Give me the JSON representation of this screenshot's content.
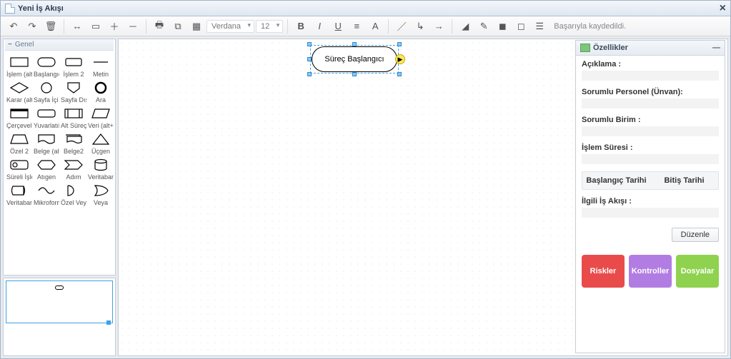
{
  "window": {
    "title": "Yeni İş Akışı"
  },
  "toolbar": {
    "font_family": "Verdana",
    "font_size": "12",
    "status": "Başarıyla kaydedildi."
  },
  "palette": {
    "group_title": "Genel",
    "shapes": [
      {
        "name": "rect",
        "label": "İşlem (alt+"
      },
      {
        "name": "roundrect",
        "label": "Başlangıç/"
      },
      {
        "name": "rect2",
        "label": "İşlem 2"
      },
      {
        "name": "text",
        "label": "Metin"
      },
      {
        "name": "diamond",
        "label": "Karar (alt+"
      },
      {
        "name": "circle",
        "label": "Sayfa İçi E"
      },
      {
        "name": "offpage",
        "label": "Sayfa Dış"
      },
      {
        "name": "boldcircle",
        "label": "Ara"
      },
      {
        "name": "frame",
        "label": "Çerçeveli"
      },
      {
        "name": "roundrect2",
        "label": "Yuvarlatılm"
      },
      {
        "name": "subprocess",
        "label": "Alt Süreç"
      },
      {
        "name": "parallelogram",
        "label": "Veri (alt+v"
      },
      {
        "name": "trapezoid",
        "label": "Özel 2"
      },
      {
        "name": "doc",
        "label": "Belge (alt+"
      },
      {
        "name": "multidoc",
        "label": "Belge2"
      },
      {
        "name": "triangle",
        "label": "Üçgen"
      },
      {
        "name": "timer",
        "label": "Süreli İşler"
      },
      {
        "name": "hexagon",
        "label": "Atıgen"
      },
      {
        "name": "step",
        "label": "Adım"
      },
      {
        "name": "cylinder",
        "label": "Veritaban"
      },
      {
        "name": "db2",
        "label": "Veritaban"
      },
      {
        "name": "microform",
        "label": "Mikroform"
      },
      {
        "name": "halfand",
        "label": "Özel Veya"
      },
      {
        "name": "halfor",
        "label": "Veya"
      }
    ]
  },
  "canvas": {
    "selected_node_label": "Süreç Başlangıcı"
  },
  "props": {
    "title": "Özellikler",
    "fields": {
      "desc_label": "Açıklama :",
      "person_label": "Sorumlu Personel (Ünvan):",
      "unit_label": "Sorumlu Birim :",
      "duration_label": "İşlem Süresi :",
      "start_date_label": "Başlangıç Tarihi",
      "end_date_label": "Bitiş Tarihi",
      "related_flow_label": "İlgili İş Akışı :",
      "edit_label": "Düzenle"
    },
    "big_buttons": {
      "risks": "Riskler",
      "controls": "Kontroller",
      "files": "Dosyalar"
    }
  }
}
